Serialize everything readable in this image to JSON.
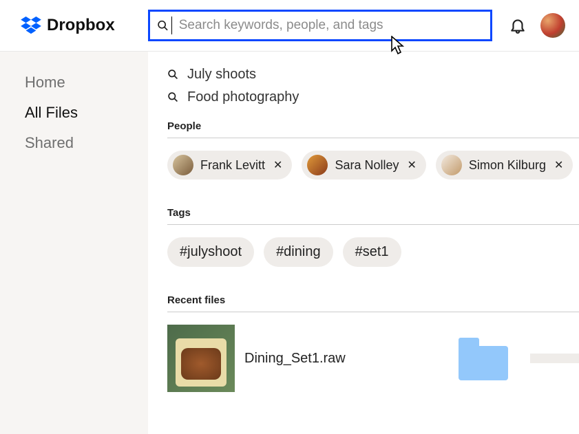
{
  "brand": {
    "name": "Dropbox"
  },
  "search": {
    "placeholder": "Search keywords, people, and tags",
    "value": ""
  },
  "sidebar": {
    "items": [
      {
        "label": "Home",
        "active": false
      },
      {
        "label": "All Files",
        "active": true
      },
      {
        "label": "Shared",
        "active": false
      }
    ]
  },
  "suggestions": [
    {
      "label": "July shoots"
    },
    {
      "label": "Food photography"
    }
  ],
  "sections": {
    "people_title": "People",
    "tags_title": "Tags",
    "recent_title": "Recent files"
  },
  "people": [
    {
      "name": "Frank Levitt"
    },
    {
      "name": "Sara Nolley"
    },
    {
      "name": "Simon Kilburg"
    }
  ],
  "tags": [
    {
      "label": "#julyshoot"
    },
    {
      "label": "#dining"
    },
    {
      "label": "#set1"
    }
  ],
  "recent": {
    "file1": {
      "name": "Dining_Set1.raw"
    }
  }
}
